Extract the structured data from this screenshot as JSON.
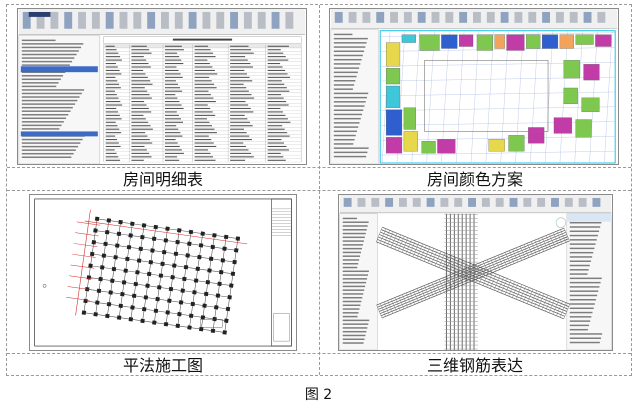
{
  "figure": {
    "label": "图 2",
    "panels": [
      {
        "caption": "房间明细表",
        "content": "room-schedule-screenshot"
      },
      {
        "caption": "房间颜色方案",
        "content": "room-color-scheme-screenshot"
      },
      {
        "caption": "平法施工图",
        "content": "plane-method-construction-drawing"
      },
      {
        "caption": "三维钢筋表达",
        "content": "3d-rebar-model-screenshot"
      }
    ]
  },
  "colors": {
    "ribbon": "#f0f0f0",
    "sheet_title_blue": "#1f4e9a",
    "plan_red": "#d42a2a",
    "room_green": "#7ec850",
    "room_magenta": "#c23ca8",
    "room_blue": "#2f5fcf",
    "room_yellow": "#e6d84a",
    "room_cyan": "#3ec7d8",
    "selection_cyan": "#19c2e8"
  }
}
